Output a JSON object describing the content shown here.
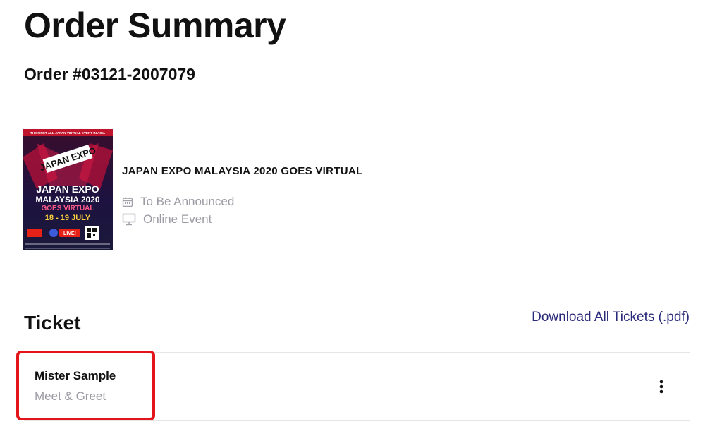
{
  "page": {
    "title": "Order Summary",
    "order_number": "Order #03121-2007079"
  },
  "event": {
    "title": "JAPAN EXPO MALAYSIA 2020 GOES VIRTUAL",
    "date": "To Be Announced",
    "date_icon": "calendar-icon",
    "location": "Online Event",
    "location_icon": "monitor-icon",
    "poster": {
      "top_banner": "THE FIRST ALL-JAPAN VIRTUAL EVENT IN ASIA",
      "logo_text": "JAPAN EXPO",
      "line1": "JAPAN EXPO",
      "line2": "MALAYSIA 2020",
      "line3": "GOES VIRTUAL",
      "dates": "18 - 19 JULY",
      "live_badge": "LIVE!"
    }
  },
  "tickets": {
    "section_title": "Ticket",
    "download_label": "Download All Tickets (.pdf)",
    "items": [
      {
        "holder": "Mister Sample",
        "type": "Meet & Greet",
        "menu_icon": "more-vertical-icon"
      }
    ]
  },
  "colors": {
    "highlight": "#e3141a",
    "link": "#2a2a7a",
    "muted_text": "#9a9aa3"
  }
}
